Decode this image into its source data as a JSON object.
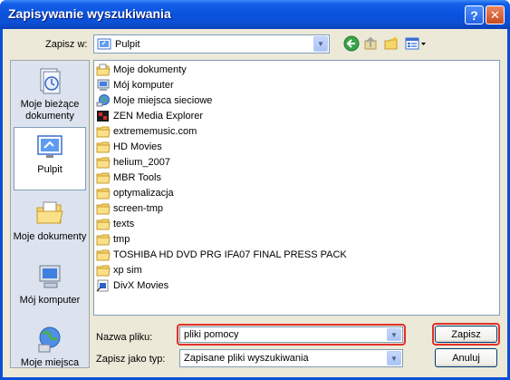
{
  "window": {
    "title": "Zapisywanie wyszukiwania"
  },
  "top": {
    "save_in_label": "Zapisz w:",
    "location": "Pulpit"
  },
  "places": [
    {
      "label": "Moje bieżące dokumenty",
      "icon": "recent-documents-icon"
    },
    {
      "label": "Pulpit",
      "icon": "desktop-icon"
    },
    {
      "label": "Moje dokumenty",
      "icon": "my-documents-icon"
    },
    {
      "label": "Mój komputer",
      "icon": "my-computer-icon"
    },
    {
      "label": "Moje miejsca",
      "icon": "network-places-icon"
    }
  ],
  "files": [
    {
      "name": "Moje dokumenty",
      "icon": "my-documents-icon"
    },
    {
      "name": "Mój komputer",
      "icon": "my-computer-icon"
    },
    {
      "name": "Moje miejsca sieciowe",
      "icon": "network-places-icon"
    },
    {
      "name": "ZEN Media Explorer",
      "icon": "zen-app-icon"
    },
    {
      "name": "extrememusic.com",
      "icon": "folder-icon"
    },
    {
      "name": "HD Movies",
      "icon": "folder-icon"
    },
    {
      "name": "helium_2007",
      "icon": "folder-icon"
    },
    {
      "name": "MBR Tools",
      "icon": "folder-icon"
    },
    {
      "name": "optymalizacja",
      "icon": "folder-icon"
    },
    {
      "name": "screen-tmp",
      "icon": "folder-icon"
    },
    {
      "name": "texts",
      "icon": "folder-icon"
    },
    {
      "name": "tmp",
      "icon": "folder-icon"
    },
    {
      "name": "TOSHIBA HD DVD PRG IFA07 FINAL PRESS PACK",
      "icon": "folder-icon"
    },
    {
      "name": "xp sim",
      "icon": "folder-icon"
    },
    {
      "name": "DivX Movies",
      "icon": "divx-shortcut-icon"
    }
  ],
  "bottom": {
    "filename_label": "Nazwa pliku:",
    "filename_value": "pliki pomocy",
    "filetype_label": "Zapisz jako typ:",
    "filetype_value": "Zapisane pliki wyszukiwania",
    "save_button": "Zapisz",
    "cancel_button": "Anuluj"
  }
}
